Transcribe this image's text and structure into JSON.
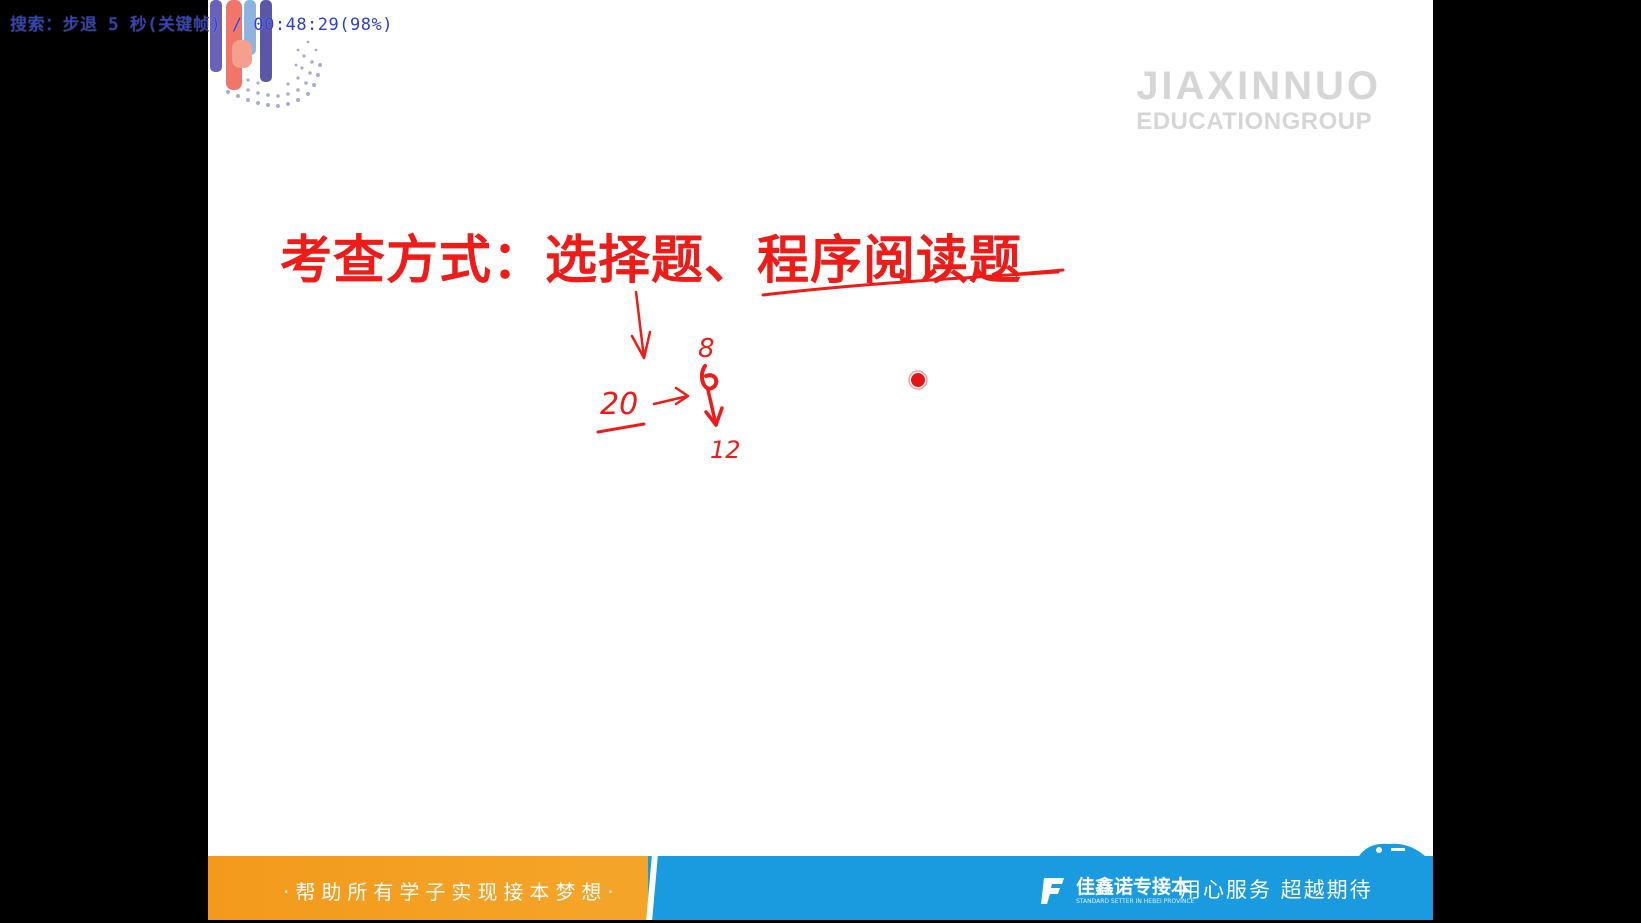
{
  "player": {
    "osd_text": "搜索：步退 5 秒(关键帧) / 00:48:29(98%)"
  },
  "slide": {
    "watermark_line1": "JIAXINNUO",
    "watermark_line2": "EDUCATIONGROUP",
    "title": "考查方式：选择题、程序阅读题",
    "annotations": {
      "num_20": "20",
      "num_8": "8",
      "num_12": "12"
    },
    "footer": {
      "slogan": "·帮助所有学子实现接本梦想·",
      "brand_name": "佳鑫诺专接本",
      "brand_sub": "STANDARD SETTER IN HEBEI PROVINCE",
      "motto": "用心服务  超越期待"
    }
  },
  "colors": {
    "title_red": "#ee1c18",
    "footer_orange": "#f39a1c",
    "footer_blue": "#1a9be0",
    "osd_blue": "#2a3fd8",
    "watermark_gray": "#d6d6d6"
  },
  "icons": {
    "corner_decoration": "colored-bars-dots-graphic",
    "brand_logo": "brand-f-logo-icon",
    "pointer": "red-pointer-dot"
  }
}
